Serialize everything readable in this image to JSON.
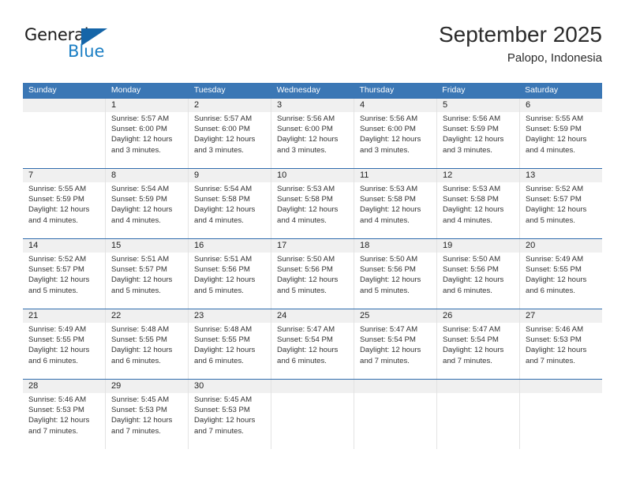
{
  "logo": {
    "primary_text": "General",
    "secondary_text": "Blue",
    "triangle_icon": "triangle-icon",
    "primary_color": "#1a1a1a",
    "secondary_color": "#1a7ec4"
  },
  "header": {
    "title": "September 2025",
    "subtitle": "Palopo, Indonesia"
  },
  "theme": {
    "header_bg": "#3b77b5",
    "header_text": "#ffffff",
    "row_border": "#2f6cad",
    "day_number_bg": "#f0f0f0",
    "cell_divider": "#e3e3e3"
  },
  "weekdays": [
    "Sunday",
    "Monday",
    "Tuesday",
    "Wednesday",
    "Thursday",
    "Friday",
    "Saturday"
  ],
  "weeks": [
    [
      {
        "number": "",
        "sunrise": "",
        "sunset": "",
        "daylight_line1": "",
        "daylight_line2": "",
        "empty": true
      },
      {
        "number": "1",
        "sunrise": "Sunrise: 5:57 AM",
        "sunset": "Sunset: 6:00 PM",
        "daylight_line1": "Daylight: 12 hours",
        "daylight_line2": "and 3 minutes.",
        "empty": false
      },
      {
        "number": "2",
        "sunrise": "Sunrise: 5:57 AM",
        "sunset": "Sunset: 6:00 PM",
        "daylight_line1": "Daylight: 12 hours",
        "daylight_line2": "and 3 minutes.",
        "empty": false
      },
      {
        "number": "3",
        "sunrise": "Sunrise: 5:56 AM",
        "sunset": "Sunset: 6:00 PM",
        "daylight_line1": "Daylight: 12 hours",
        "daylight_line2": "and 3 minutes.",
        "empty": false
      },
      {
        "number": "4",
        "sunrise": "Sunrise: 5:56 AM",
        "sunset": "Sunset: 6:00 PM",
        "daylight_line1": "Daylight: 12 hours",
        "daylight_line2": "and 3 minutes.",
        "empty": false
      },
      {
        "number": "5",
        "sunrise": "Sunrise: 5:56 AM",
        "sunset": "Sunset: 5:59 PM",
        "daylight_line1": "Daylight: 12 hours",
        "daylight_line2": "and 3 minutes.",
        "empty": false
      },
      {
        "number": "6",
        "sunrise": "Sunrise: 5:55 AM",
        "sunset": "Sunset: 5:59 PM",
        "daylight_line1": "Daylight: 12 hours",
        "daylight_line2": "and 4 minutes.",
        "empty": false
      }
    ],
    [
      {
        "number": "7",
        "sunrise": "Sunrise: 5:55 AM",
        "sunset": "Sunset: 5:59 PM",
        "daylight_line1": "Daylight: 12 hours",
        "daylight_line2": "and 4 minutes.",
        "empty": false
      },
      {
        "number": "8",
        "sunrise": "Sunrise: 5:54 AM",
        "sunset": "Sunset: 5:59 PM",
        "daylight_line1": "Daylight: 12 hours",
        "daylight_line2": "and 4 minutes.",
        "empty": false
      },
      {
        "number": "9",
        "sunrise": "Sunrise: 5:54 AM",
        "sunset": "Sunset: 5:58 PM",
        "daylight_line1": "Daylight: 12 hours",
        "daylight_line2": "and 4 minutes.",
        "empty": false
      },
      {
        "number": "10",
        "sunrise": "Sunrise: 5:53 AM",
        "sunset": "Sunset: 5:58 PM",
        "daylight_line1": "Daylight: 12 hours",
        "daylight_line2": "and 4 minutes.",
        "empty": false
      },
      {
        "number": "11",
        "sunrise": "Sunrise: 5:53 AM",
        "sunset": "Sunset: 5:58 PM",
        "daylight_line1": "Daylight: 12 hours",
        "daylight_line2": "and 4 minutes.",
        "empty": false
      },
      {
        "number": "12",
        "sunrise": "Sunrise: 5:53 AM",
        "sunset": "Sunset: 5:58 PM",
        "daylight_line1": "Daylight: 12 hours",
        "daylight_line2": "and 4 minutes.",
        "empty": false
      },
      {
        "number": "13",
        "sunrise": "Sunrise: 5:52 AM",
        "sunset": "Sunset: 5:57 PM",
        "daylight_line1": "Daylight: 12 hours",
        "daylight_line2": "and 5 minutes.",
        "empty": false
      }
    ],
    [
      {
        "number": "14",
        "sunrise": "Sunrise: 5:52 AM",
        "sunset": "Sunset: 5:57 PM",
        "daylight_line1": "Daylight: 12 hours",
        "daylight_line2": "and 5 minutes.",
        "empty": false
      },
      {
        "number": "15",
        "sunrise": "Sunrise: 5:51 AM",
        "sunset": "Sunset: 5:57 PM",
        "daylight_line1": "Daylight: 12 hours",
        "daylight_line2": "and 5 minutes.",
        "empty": false
      },
      {
        "number": "16",
        "sunrise": "Sunrise: 5:51 AM",
        "sunset": "Sunset: 5:56 PM",
        "daylight_line1": "Daylight: 12 hours",
        "daylight_line2": "and 5 minutes.",
        "empty": false
      },
      {
        "number": "17",
        "sunrise": "Sunrise: 5:50 AM",
        "sunset": "Sunset: 5:56 PM",
        "daylight_line1": "Daylight: 12 hours",
        "daylight_line2": "and 5 minutes.",
        "empty": false
      },
      {
        "number": "18",
        "sunrise": "Sunrise: 5:50 AM",
        "sunset": "Sunset: 5:56 PM",
        "daylight_line1": "Daylight: 12 hours",
        "daylight_line2": "and 5 minutes.",
        "empty": false
      },
      {
        "number": "19",
        "sunrise": "Sunrise: 5:50 AM",
        "sunset": "Sunset: 5:56 PM",
        "daylight_line1": "Daylight: 12 hours",
        "daylight_line2": "and 6 minutes.",
        "empty": false
      },
      {
        "number": "20",
        "sunrise": "Sunrise: 5:49 AM",
        "sunset": "Sunset: 5:55 PM",
        "daylight_line1": "Daylight: 12 hours",
        "daylight_line2": "and 6 minutes.",
        "empty": false
      }
    ],
    [
      {
        "number": "21",
        "sunrise": "Sunrise: 5:49 AM",
        "sunset": "Sunset: 5:55 PM",
        "daylight_line1": "Daylight: 12 hours",
        "daylight_line2": "and 6 minutes.",
        "empty": false
      },
      {
        "number": "22",
        "sunrise": "Sunrise: 5:48 AM",
        "sunset": "Sunset: 5:55 PM",
        "daylight_line1": "Daylight: 12 hours",
        "daylight_line2": "and 6 minutes.",
        "empty": false
      },
      {
        "number": "23",
        "sunrise": "Sunrise: 5:48 AM",
        "sunset": "Sunset: 5:55 PM",
        "daylight_line1": "Daylight: 12 hours",
        "daylight_line2": "and 6 minutes.",
        "empty": false
      },
      {
        "number": "24",
        "sunrise": "Sunrise: 5:47 AM",
        "sunset": "Sunset: 5:54 PM",
        "daylight_line1": "Daylight: 12 hours",
        "daylight_line2": "and 6 minutes.",
        "empty": false
      },
      {
        "number": "25",
        "sunrise": "Sunrise: 5:47 AM",
        "sunset": "Sunset: 5:54 PM",
        "daylight_line1": "Daylight: 12 hours",
        "daylight_line2": "and 7 minutes.",
        "empty": false
      },
      {
        "number": "26",
        "sunrise": "Sunrise: 5:47 AM",
        "sunset": "Sunset: 5:54 PM",
        "daylight_line1": "Daylight: 12 hours",
        "daylight_line2": "and 7 minutes.",
        "empty": false
      },
      {
        "number": "27",
        "sunrise": "Sunrise: 5:46 AM",
        "sunset": "Sunset: 5:53 PM",
        "daylight_line1": "Daylight: 12 hours",
        "daylight_line2": "and 7 minutes.",
        "empty": false
      }
    ],
    [
      {
        "number": "28",
        "sunrise": "Sunrise: 5:46 AM",
        "sunset": "Sunset: 5:53 PM",
        "daylight_line1": "Daylight: 12 hours",
        "daylight_line2": "and 7 minutes.",
        "empty": false
      },
      {
        "number": "29",
        "sunrise": "Sunrise: 5:45 AM",
        "sunset": "Sunset: 5:53 PM",
        "daylight_line1": "Daylight: 12 hours",
        "daylight_line2": "and 7 minutes.",
        "empty": false
      },
      {
        "number": "30",
        "sunrise": "Sunrise: 5:45 AM",
        "sunset": "Sunset: 5:53 PM",
        "daylight_line1": "Daylight: 12 hours",
        "daylight_line2": "and 7 minutes.",
        "empty": false
      },
      {
        "number": "",
        "sunrise": "",
        "sunset": "",
        "daylight_line1": "",
        "daylight_line2": "",
        "empty": true
      },
      {
        "number": "",
        "sunrise": "",
        "sunset": "",
        "daylight_line1": "",
        "daylight_line2": "",
        "empty": true
      },
      {
        "number": "",
        "sunrise": "",
        "sunset": "",
        "daylight_line1": "",
        "daylight_line2": "",
        "empty": true
      },
      {
        "number": "",
        "sunrise": "",
        "sunset": "",
        "daylight_line1": "",
        "daylight_line2": "",
        "empty": true
      }
    ]
  ]
}
